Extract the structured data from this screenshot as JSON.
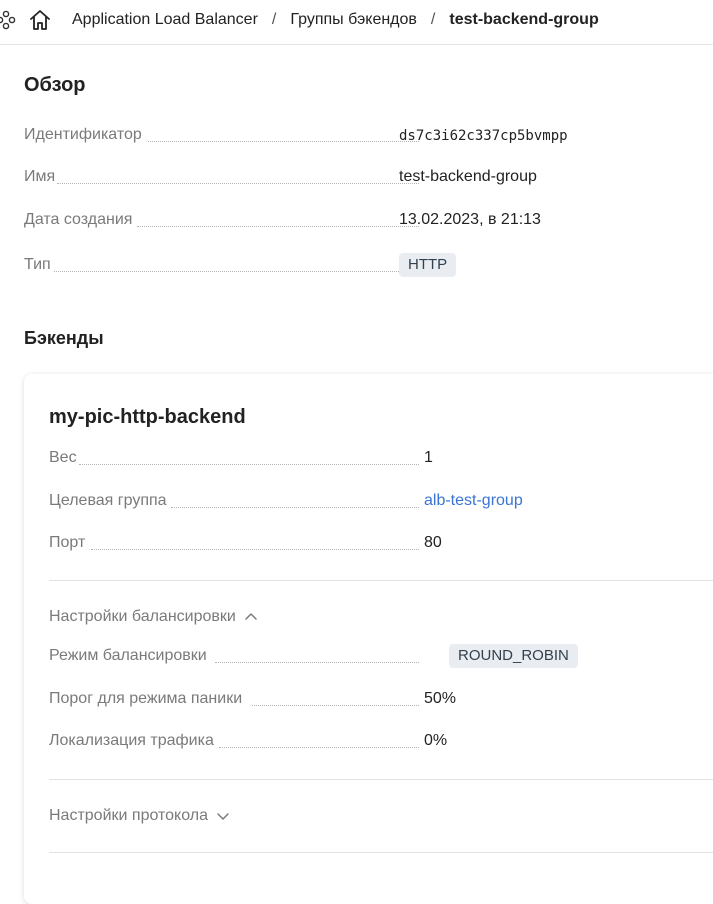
{
  "breadcrumb": {
    "service_icon": "nodes-icon",
    "home_icon": "home-icon",
    "items": [
      "Application Load Balancer",
      "Группы бэкендов"
    ],
    "separator": "/",
    "current": "test-backend-group"
  },
  "overview": {
    "title": "Обзор",
    "rows": [
      {
        "label": "Идентификатор",
        "value": "ds7c3i62c337cp5bvmpp"
      },
      {
        "label": "Имя",
        "value": "test-backend-group"
      },
      {
        "label": "Дата создания",
        "value": "13.02.2023, в 21:13"
      },
      {
        "label": "Тип",
        "value": "HTTP"
      }
    ]
  },
  "backends": {
    "title": "Бэкенды",
    "card": {
      "name": "my-pic-http-backend",
      "rows": [
        {
          "label": "Вес",
          "value": "1"
        },
        {
          "label": "Целевая группа",
          "value": "alb-test-group"
        },
        {
          "label": "Порт",
          "value": "80"
        }
      ],
      "balancing": {
        "toggle_label": "Настройки балансировки",
        "expanded": true,
        "rows": [
          {
            "label": "Режим балансировки",
            "value": "ROUND_ROBIN"
          },
          {
            "label": "Порог для режима паники",
            "value": "50%"
          },
          {
            "label": "Локализация трафика",
            "value": "0%"
          }
        ]
      },
      "protocol": {
        "toggle_label": "Настройки протокола",
        "expanded": false
      }
    }
  },
  "colors": {
    "link": "#3a75d3",
    "label": "#7a7a7a",
    "badge_bg": "#e9edf2",
    "divider": "#e2e2e2"
  }
}
